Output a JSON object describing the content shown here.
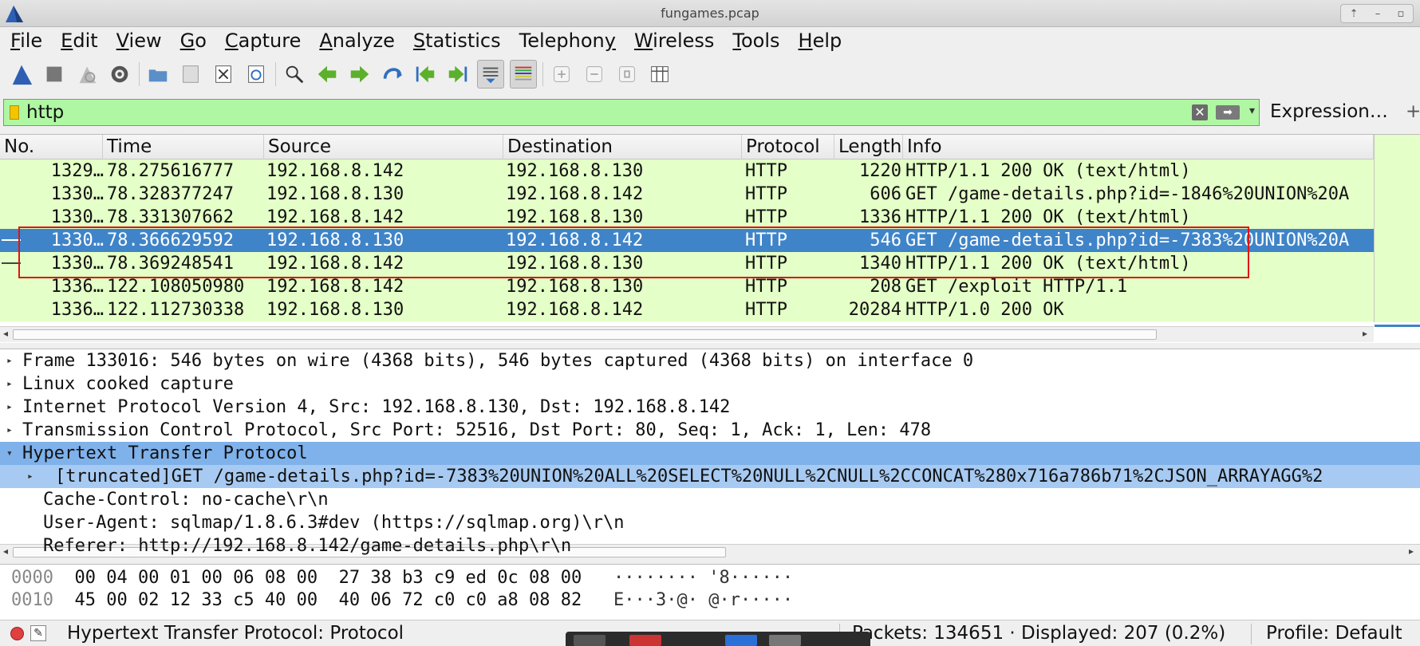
{
  "window": {
    "title": "fungames.pcap"
  },
  "menu": [
    {
      "u": "F",
      "rest": "ile"
    },
    {
      "u": "E",
      "rest": "dit"
    },
    {
      "u": "V",
      "rest": "iew"
    },
    {
      "u": "G",
      "rest": "o"
    },
    {
      "u": "C",
      "rest": "apture"
    },
    {
      "u": "A",
      "rest": "nalyze"
    },
    {
      "u": "S",
      "rest": "tatistics"
    },
    {
      "pre": "Telephon",
      "u": "y",
      "rest": ""
    },
    {
      "u": "W",
      "rest": "ireless"
    },
    {
      "u": "T",
      "rest": "ools"
    },
    {
      "u": "H",
      "rest": "elp"
    }
  ],
  "toolbar": {
    "icons": [
      "shark-fin-icon",
      "stop-icon",
      "restart-icon",
      "options-gear-icon",
      "sep",
      "open-folder-icon",
      "save-icon",
      "close-file-icon",
      "reload-icon",
      "sep",
      "find-icon",
      "back-arrow-icon",
      "forward-arrow-icon",
      "goto-packet-icon",
      "first-packet-icon",
      "last-packet-icon",
      "autoscroll-icon",
      "colorize-icon",
      "sep",
      "zoom-in-icon",
      "zoom-out-icon",
      "normal-size-icon",
      "resize-columns-icon"
    ]
  },
  "filter": {
    "value": "http",
    "expression_label": "Expression…",
    "plus": "+"
  },
  "packet_list": {
    "columns": [
      "No.",
      "Time",
      "Source",
      "Destination",
      "Protocol",
      "Length",
      "Info"
    ],
    "rows": [
      {
        "no": "1329…",
        "time": "78.275616777",
        "src": "192.168.8.142",
        "dst": "192.168.8.130",
        "proto": "HTTP",
        "len": "1220",
        "info": "HTTP/1.1 200 OK  (text/html)",
        "selected": false,
        "related": false
      },
      {
        "no": "1330…",
        "time": "78.328377247",
        "src": "192.168.8.130",
        "dst": "192.168.8.142",
        "proto": "HTTP",
        "len": "606",
        "info": "GET /game-details.php?id=-1846%20UNION%20A",
        "selected": false,
        "related": false
      },
      {
        "no": "1330…",
        "time": "78.331307662",
        "src": "192.168.8.142",
        "dst": "192.168.8.130",
        "proto": "HTTP",
        "len": "1336",
        "info": "HTTP/1.1 200 OK  (text/html)",
        "selected": false,
        "related": false
      },
      {
        "no": "1330…",
        "time": "78.366629592",
        "src": "192.168.8.130",
        "dst": "192.168.8.142",
        "proto": "HTTP",
        "len": "546",
        "info": "GET /game-details.php?id=-7383%20UNION%20A",
        "selected": true,
        "related": true
      },
      {
        "no": "1330…",
        "time": "78.369248541",
        "src": "192.168.8.142",
        "dst": "192.168.8.130",
        "proto": "HTTP",
        "len": "1340",
        "info": "HTTP/1.1 200 OK  (text/html)",
        "selected": false,
        "related": true
      },
      {
        "no": "1336…",
        "time": "122.108050980",
        "src": "192.168.8.142",
        "dst": "192.168.8.130",
        "proto": "HTTP",
        "len": "208",
        "info": "GET /exploit HTTP/1.1",
        "selected": false,
        "related": false
      },
      {
        "no": "1336…",
        "time": "122.112730338",
        "src": "192.168.8.130",
        "dst": "192.168.8.142",
        "proto": "HTTP",
        "len": "20284",
        "info": "HTTP/1.0 200 OK",
        "selected": false,
        "related": false
      }
    ]
  },
  "details": [
    {
      "text": "Frame 133016: 546 bytes on wire (4368 bits), 546 bytes captured (4368 bits) on interface 0",
      "expand": "collapsed",
      "level": 0,
      "style": ""
    },
    {
      "text": "Linux cooked capture",
      "expand": "collapsed",
      "level": 0,
      "style": ""
    },
    {
      "text": "Internet Protocol Version 4, Src: 192.168.8.130, Dst: 192.168.8.142",
      "expand": "collapsed",
      "level": 0,
      "style": ""
    },
    {
      "text": "Transmission Control Protocol, Src Port: 52516, Dst Port: 80, Seq: 1, Ack: 1, Len: 478",
      "expand": "collapsed",
      "level": 0,
      "style": ""
    },
    {
      "text": "Hypertext Transfer Protocol",
      "expand": "expanded",
      "level": 0,
      "style": "sel"
    },
    {
      "text": "[truncated]GET /game-details.php?id=-7383%20UNION%20ALL%20SELECT%20NULL%2CNULL%2CCONCAT%280x716a786b71%2CJSON_ARRAYAGG%2",
      "expand": "collapsed",
      "level": 1,
      "style": "sel2"
    },
    {
      "text": "Cache-Control: no-cache\\r\\n",
      "expand": "none",
      "level": 1,
      "style": ""
    },
    {
      "text": "User-Agent: sqlmap/1.8.6.3#dev (https://sqlmap.org)\\r\\n",
      "expand": "none",
      "level": 1,
      "style": ""
    },
    {
      "text": "Referer: http://192.168.8.142/game-details.php\\r\\n",
      "expand": "none",
      "level": 1,
      "style": ""
    }
  ],
  "bytes": [
    {
      "offset": "0000",
      "hex": "00 04 00 01 00 06 08 00  27 38 b3 c9 ed 0c 08 00",
      "ascii": "········ '8······"
    },
    {
      "offset": "0010",
      "hex": "45 00 02 12 33 c5 40 00  40 06 72 c0 c0 a8 08 82",
      "ascii": "E···3·@· @·r·····"
    }
  ],
  "status": {
    "message": "Hypertext Transfer Protocol: Protocol",
    "packets": "Packets: 134651 · Displayed: 207 (0.2%)",
    "profile": "Profile: Default"
  },
  "colors": {
    "row_http": "#e4ffc7",
    "row_selected": "#3f84c8",
    "filter_valid": "#aff7a3",
    "detail_selected": "#7fb1ea",
    "annotation_box": "#e01313"
  }
}
